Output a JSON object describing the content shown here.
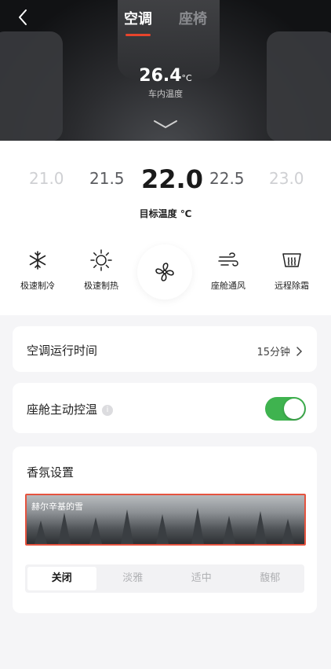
{
  "header": {
    "tabs": [
      {
        "label": "空调",
        "active": true
      },
      {
        "label": "座椅",
        "active": false
      }
    ],
    "inside_temp": "26.4",
    "inside_unit": "°C",
    "inside_label": "车内温度",
    "back_icon": "chevron-left-icon",
    "expand_icon": "chevron-down-icon"
  },
  "temperature": {
    "options": [
      "21.0",
      "21.5",
      "22.0",
      "22.5",
      "23.0"
    ],
    "selected": "22.0",
    "label": "目标温度 ℃"
  },
  "modes": [
    {
      "label": "极速制冷",
      "icon": "snowflake-icon"
    },
    {
      "label": "极速制热",
      "icon": "sun-icon"
    },
    {
      "label": "",
      "icon": "fan-icon"
    },
    {
      "label": "座舱通风",
      "icon": "wind-icon"
    },
    {
      "label": "远程除霜",
      "icon": "defrost-icon"
    }
  ],
  "runtime": {
    "title": "空调运行时间",
    "value": "15分钟"
  },
  "cabin_temp": {
    "title": "座舱主动控温",
    "info": "i",
    "enabled": true
  },
  "scent": {
    "title": "香氛设置",
    "selected_name": "赫尔辛基的雪",
    "levels": [
      "关闭",
      "淡雅",
      "适中",
      "馥郁"
    ],
    "selected_level": "关闭"
  },
  "colors": {
    "accent": "#e8452c",
    "toggle_on": "#3fb34f"
  }
}
